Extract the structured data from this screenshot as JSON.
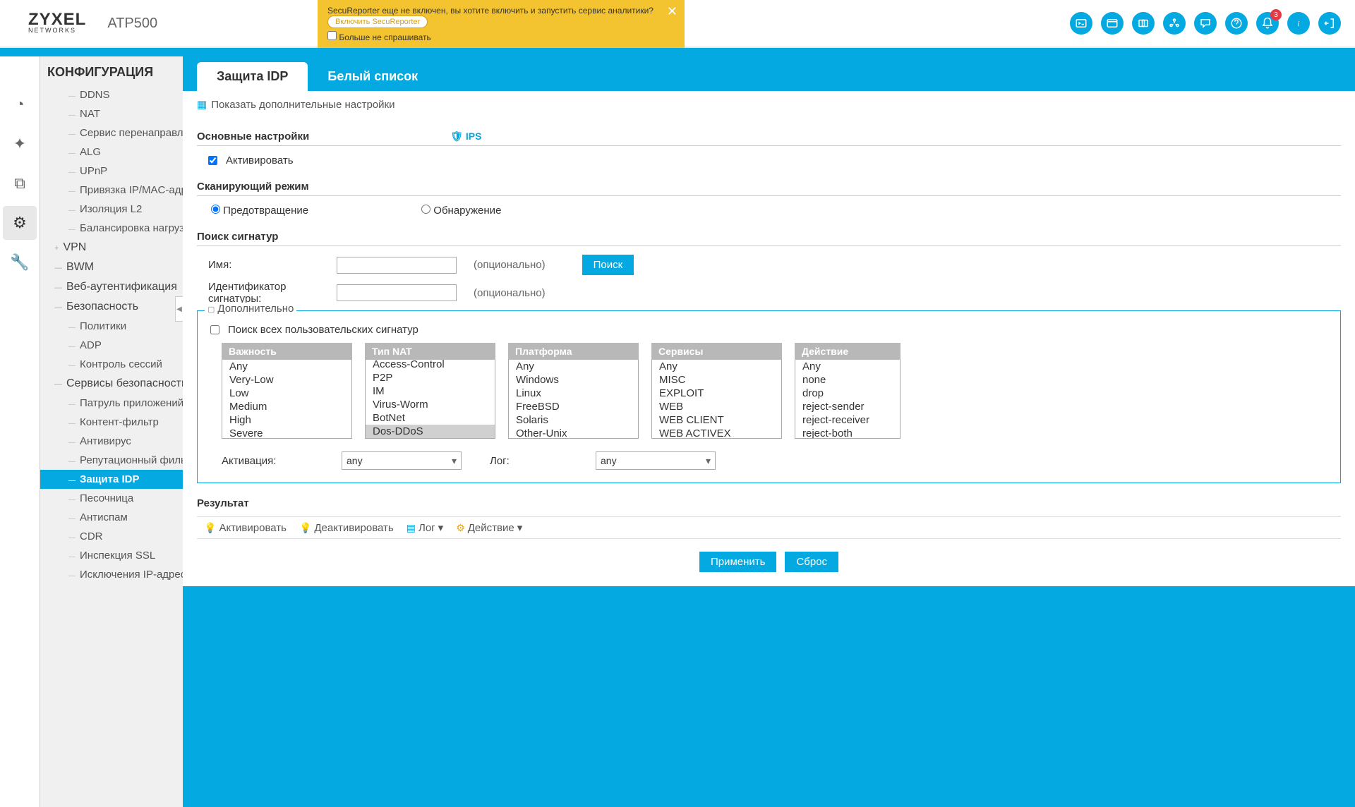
{
  "header": {
    "brand": "ZYXEL",
    "brand_sub": "NETWORKS",
    "model": "ATP500",
    "notif": {
      "msg1": "SecuReporter еще не включен, вы хотите включить и запустить сервис аналитики?",
      "btn": "Включить SecuReporter",
      "dont_ask": "Больше не спрашивать"
    },
    "badge_count": "3"
  },
  "sidebar": {
    "title": "КОНФИГУРАЦИЯ",
    "items": [
      {
        "label": "DDNS",
        "lvl": 2
      },
      {
        "label": "NAT",
        "lvl": 2
      },
      {
        "label": "Сервис перенаправления",
        "lvl": 2
      },
      {
        "label": "ALG",
        "lvl": 2
      },
      {
        "label": "UPnP",
        "lvl": 2
      },
      {
        "label": "Привязка IP/MAC-адресов",
        "lvl": 2
      },
      {
        "label": "Изоляция L2",
        "lvl": 2
      },
      {
        "label": "Балансировка нагрузки",
        "lvl": 2
      },
      {
        "label": "VPN",
        "lvl": 1,
        "plus": true
      },
      {
        "label": "BWM",
        "lvl": 1
      },
      {
        "label": "Веб-аутентификация",
        "lvl": 1
      },
      {
        "label": "Безопасность",
        "lvl": 1
      },
      {
        "label": "Политики",
        "lvl": 2
      },
      {
        "label": "ADP",
        "lvl": 2
      },
      {
        "label": "Контроль сессий",
        "lvl": 2
      },
      {
        "label": "Сервисы безопасности",
        "lvl": 1
      },
      {
        "label": "Патруль приложений",
        "lvl": 2
      },
      {
        "label": "Контент-фильтр",
        "lvl": 2
      },
      {
        "label": "Антивирус",
        "lvl": 2
      },
      {
        "label": "Репутационный фильтр",
        "lvl": 2
      },
      {
        "label": "Защита IDP",
        "lvl": 2,
        "active": true
      },
      {
        "label": "Песочница",
        "lvl": 2
      },
      {
        "label": "Антиспам",
        "lvl": 2
      },
      {
        "label": "CDR",
        "lvl": 2
      },
      {
        "label": "Инспекция SSL",
        "lvl": 2
      },
      {
        "label": "Исключения IP-адресов",
        "lvl": 2
      }
    ]
  },
  "tabs": {
    "t1": "Защита IDP",
    "t2": "Белый список"
  },
  "panel": {
    "show_adv": "Показать дополнительные настройки",
    "basic": "Основные настройки",
    "ips": "IPS",
    "activate": "Активировать",
    "scan_mode": "Сканирующий режим",
    "prevent": "Предотвращение",
    "detect": "Обнаружение",
    "sig_search": "Поиск сигнатур",
    "name": "Имя:",
    "sig_id": "Идентификатор сигнатуры:",
    "optional": "(опционально)",
    "search": "Поиск",
    "advanced": "Дополнительно",
    "search_all": "Поиск всех пользовательских сигнатур",
    "cols": {
      "severity": "Важность",
      "nat_type": "Тип NAT",
      "platform": "Платформа",
      "services": "Сервисы",
      "action": "Действие"
    },
    "severity": [
      "Any",
      "Very-Low",
      "Low",
      "Medium",
      "High",
      "Severe"
    ],
    "nat_type": [
      "Access-Control",
      "P2P",
      "IM",
      "Virus-Worm",
      "BotNet",
      "Dos-DDoS"
    ],
    "nat_type_selected": "Dos-DDoS",
    "platform": [
      "Any",
      "Windows",
      "Linux",
      "FreeBSD",
      "Solaris",
      "Other-Unix"
    ],
    "services": [
      "Any",
      "MISC",
      "EXPLOIT",
      "WEB",
      "WEB CLIENT",
      "WEB ACTIVEX"
    ],
    "actions": [
      "Any",
      "none",
      "drop",
      "reject-sender",
      "reject-receiver",
      "reject-both"
    ],
    "activation": "Активация:",
    "activation_val": "any",
    "log": "Лог:",
    "log_val": "any",
    "result": "Результат",
    "tool_activate": "Активировать",
    "tool_deactivate": "Деактивировать",
    "tool_log": "Лог",
    "tool_action": "Действие",
    "apply": "Применить",
    "reset": "Сброс"
  }
}
